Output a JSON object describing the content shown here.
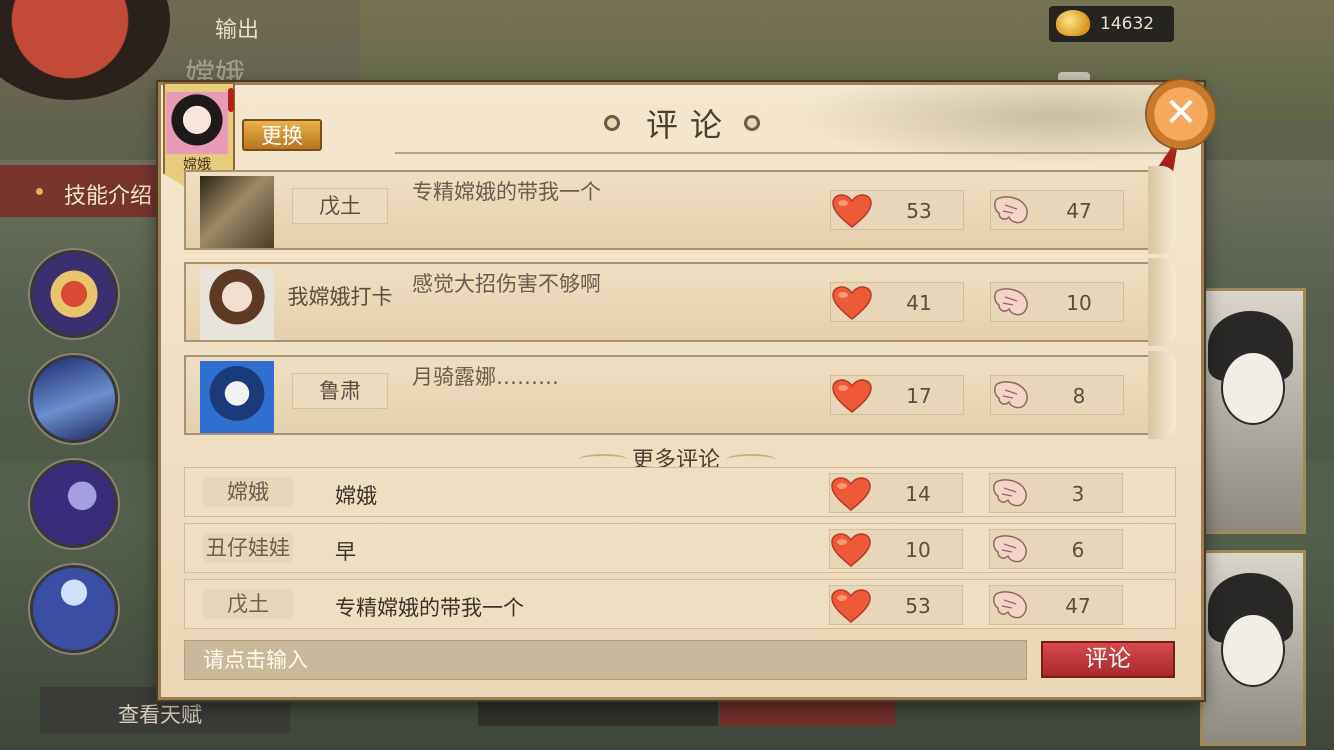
{
  "background": {
    "subtitle": "输出",
    "hero_name": "嫦娥",
    "skill_intro_label": "技能介绍",
    "talent_button": "查看天赋",
    "gold_amount": "14632"
  },
  "dialog": {
    "title": "评论",
    "hero_tag": "嫦娥",
    "change_button": "更换",
    "more_comments_label": "更多评论",
    "input_placeholder": "请点击输入",
    "submit_button": "评论"
  },
  "top_comments": [
    {
      "name": "戊土",
      "text": "专精嫦娥的带我一个",
      "likes": "53",
      "dislikes": "47"
    },
    {
      "name": "我嫦娥打卡",
      "text": "感觉大招伤害不够啊",
      "likes": "41",
      "dislikes": "10"
    },
    {
      "name": "鲁肃",
      "text": "月骑露娜………",
      "likes": "17",
      "dislikes": "8"
    }
  ],
  "more_comments": [
    {
      "name": "嫦娥",
      "text": "嫦娥",
      "likes": "14",
      "dislikes": "3"
    },
    {
      "name": "丑仔娃娃",
      "text": "早",
      "likes": "10",
      "dislikes": "6"
    },
    {
      "name": "戊土",
      "text": "专精嫦娥的带我一个",
      "likes": "53",
      "dislikes": "47"
    }
  ],
  "icons": {
    "like": "heart-icon",
    "dislike": "thumb-down-icon",
    "close": "close-icon",
    "currency": "gold-ingot-icon"
  },
  "colors": {
    "accent_red": "#b72a22",
    "parchment": "#efdfc2",
    "gold": "#e9b24a"
  }
}
